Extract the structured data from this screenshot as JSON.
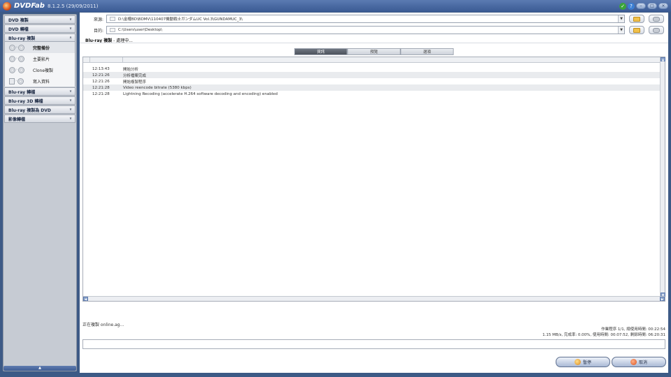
{
  "app": {
    "name": "DVDFab",
    "version": "8.1.2.5 (29/09/2011)"
  },
  "titlebar": {
    "check_glyph": "✓",
    "help_glyph": "?",
    "minimize_glyph": "–",
    "maximize_glyph": "□",
    "close_glyph": "×"
  },
  "sidebar": {
    "chevron_collapsed": "∨",
    "chevron_expanded": "∧",
    "sections_top": [
      {
        "label": "DVD 複製"
      },
      {
        "label": "DVD 轉檔"
      }
    ],
    "active_section": {
      "label": "Blu-ray 複製",
      "items": [
        {
          "label": "完整備份",
          "icon": "disc-icon"
        },
        {
          "label": "主要影片",
          "icon": "disc-icon"
        },
        {
          "label": "Clone複製",
          "icon": "disc-icon"
        },
        {
          "label": "寫入資料",
          "icon": "doc-icon"
        }
      ]
    },
    "sections_bottom": [
      {
        "label": "Blu-ray 轉檔"
      },
      {
        "label": "Blu-ray 3D 轉檔"
      },
      {
        "label": "Blu-ray 複製為 DVD"
      },
      {
        "label": "影像轉檔"
      }
    ],
    "footer_glyph": "▲"
  },
  "source": {
    "label": "來源:",
    "value": "D:\\金權BD\\BDMV\\110407機動戦士ガンダムUC Vol.3\\GUNDAMUC_3\\"
  },
  "target": {
    "label": "目的:",
    "value": "C:\\Users\\user\\Desktop\\"
  },
  "dropdown_glyph": "▼",
  "breadcrumb": {
    "mode": "Blu-ray 複製",
    "status": " - 處理中..."
  },
  "tabs": [
    {
      "label": "資訊",
      "active": true
    },
    {
      "label": "預覽",
      "active": false
    },
    {
      "label": "選項",
      "active": false
    }
  ],
  "log": [
    {
      "time": "12:13:43",
      "message": "開始分析"
    },
    {
      "time": "12:21:26",
      "message": "分析檔案完成"
    },
    {
      "time": "12:21:26",
      "message": "開始複製程序"
    },
    {
      "time": "12:21:28",
      "message": "Video reencode bitrate (5380 kbps)"
    },
    {
      "time": "12:21:28",
      "message": "Lightning Recoding (accelerate H.264 software decoding and encoding) enabled"
    }
  ],
  "scroll_glyphs": {
    "left": "◀",
    "right": "▶",
    "up": "▲",
    "down": "▼"
  },
  "status_text": "正在複製 online.ag...",
  "stats": {
    "line1": "作業程序 1/1, 總使用時間: 00:22:54",
    "line2": "1.15 MB/s, 完成率: 0.00%, 使用時間: 00:07:52, 剩餘時間: 06:20:31"
  },
  "buttons": {
    "pause": "暫停",
    "cancel": "取消"
  },
  "colors": {
    "titlebar": "#3a5a93",
    "active_tab": "#4c525c",
    "sidebar_bg": "#c6cbd3"
  }
}
